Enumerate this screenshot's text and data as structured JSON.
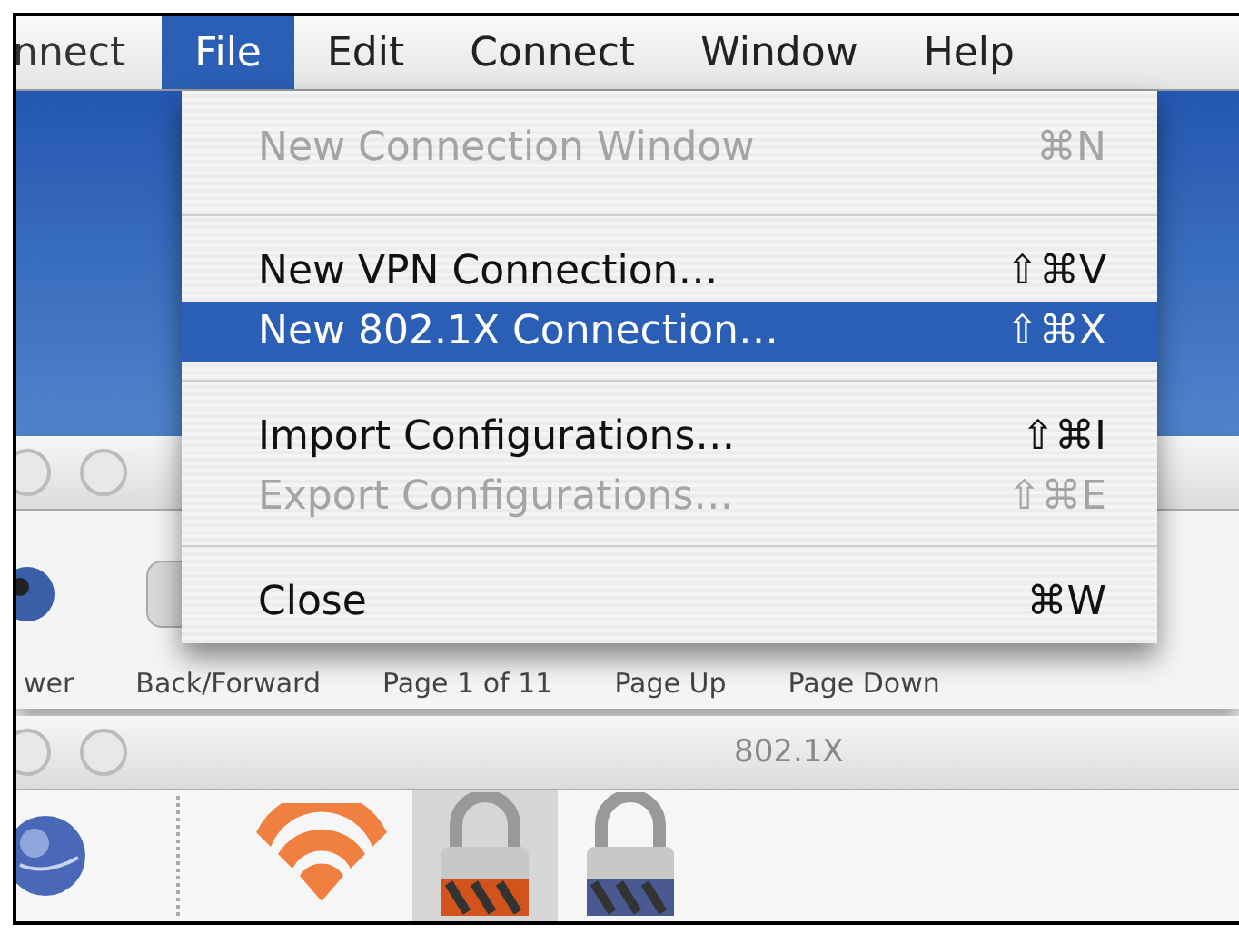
{
  "menu_bar": {
    "items": [
      {
        "label": "nnect",
        "selected": false
      },
      {
        "label": "File",
        "selected": true
      },
      {
        "label": "Edit",
        "selected": false
      },
      {
        "label": "Connect",
        "selected": false
      },
      {
        "label": "Window",
        "selected": false
      },
      {
        "label": "Help",
        "selected": false
      }
    ]
  },
  "menu": {
    "items": [
      {
        "kind": "item",
        "label": "New Connection Window",
        "shortcut": "⌘N",
        "disabled": true,
        "selected": false
      },
      {
        "kind": "separator"
      },
      {
        "kind": "item",
        "label": "New VPN Connection…",
        "shortcut": "⇧⌘V",
        "disabled": false,
        "selected": false
      },
      {
        "kind": "item",
        "label": "New 802.1X Connection…",
        "shortcut": "⇧⌘X",
        "disabled": false,
        "selected": true
      },
      {
        "kind": "separator"
      },
      {
        "kind": "item",
        "label": "Import Configurations…",
        "shortcut": "⇧⌘I",
        "disabled": false,
        "selected": false
      },
      {
        "kind": "item",
        "label": "Export Configurations…",
        "shortcut": "⇧⌘E",
        "disabled": true,
        "selected": false
      },
      {
        "kind": "separator"
      },
      {
        "kind": "item",
        "label": "Close",
        "shortcut": "⌘W",
        "disabled": false,
        "selected": false
      }
    ]
  },
  "back_window": {
    "toolbar_labels": [
      "wer",
      "Back/Forward",
      "Page 1 of 11",
      "Page Up",
      "Page Down"
    ]
  },
  "front_window": {
    "title": "802.1X",
    "toolbar_items": [
      {
        "kind": "globe",
        "selected": false
      },
      {
        "kind": "separator"
      },
      {
        "kind": "wifi",
        "selected": false
      },
      {
        "kind": "lock-orange",
        "selected": true
      },
      {
        "kind": "lock-blue",
        "selected": false
      }
    ]
  }
}
